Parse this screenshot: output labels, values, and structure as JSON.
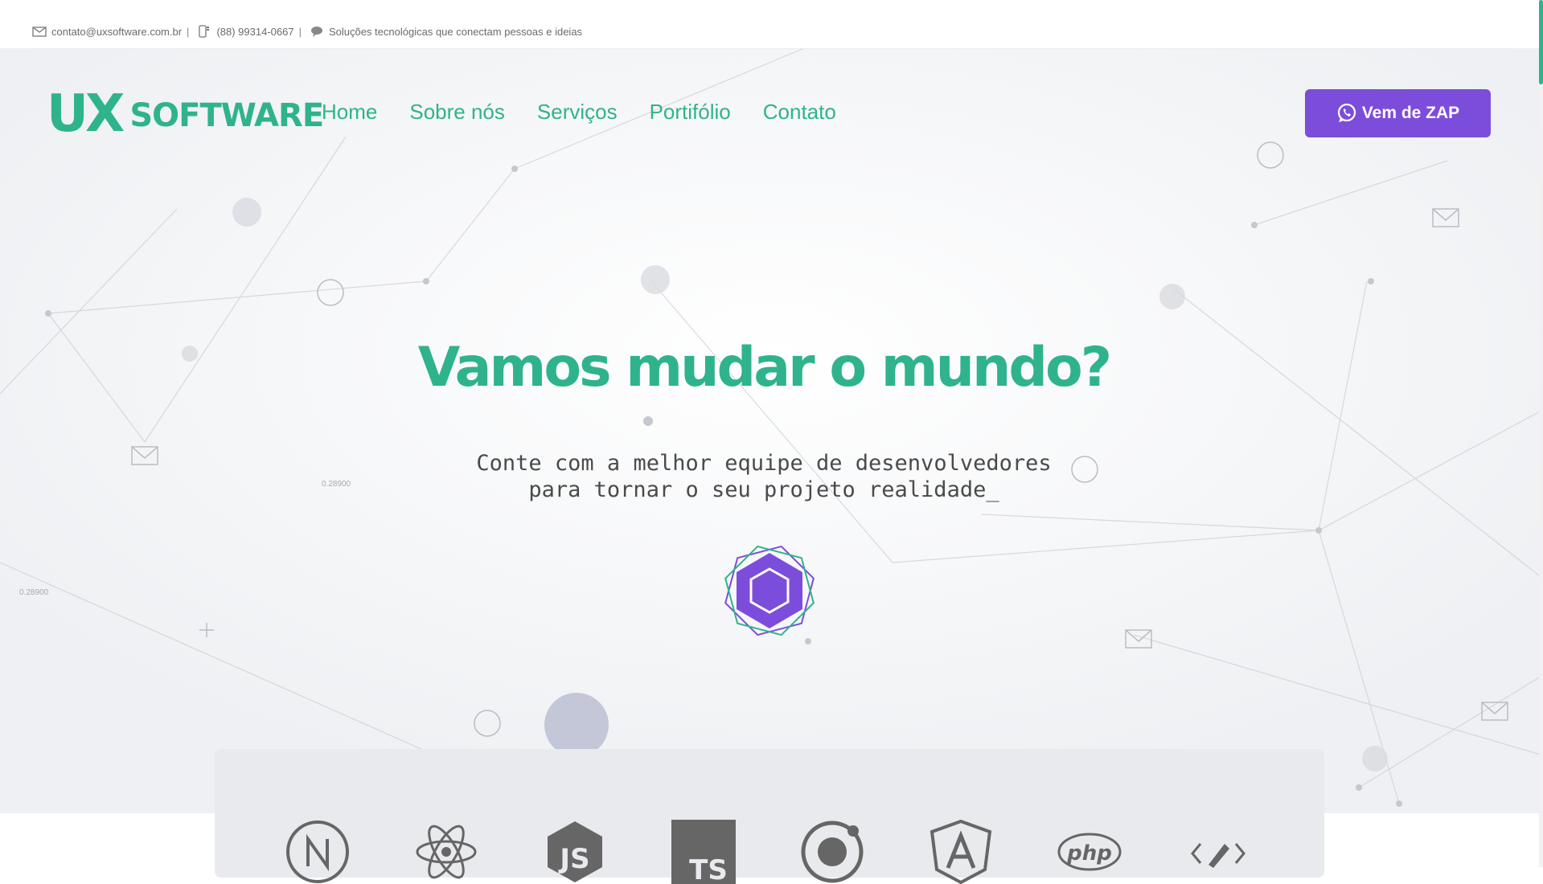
{
  "topbar": {
    "email": "contato@uxsoftware.com.br",
    "phone": "(88) 99314-0667",
    "tagline": "Soluções tecnológicas que conectam pessoas e ideias",
    "separator": "|"
  },
  "brand": {
    "mark": "UX",
    "word": "SOFTWARE"
  },
  "nav": {
    "items": [
      "Home",
      "Sobre nós",
      "Serviços",
      "Portifólio",
      "Contato"
    ]
  },
  "cta": {
    "label": "Vem de ZAP"
  },
  "hero": {
    "title": "Vamos mudar o mundo?",
    "subtitle": "Conte com a melhor equipe de desenvolvedores\npara tornar o seu projeto realidade_"
  },
  "background_labels": [
    "0.28900",
    "0.28900"
  ],
  "tech_icons": [
    "nextjs-icon",
    "react-icon",
    "nodejs-icon",
    "typescript-icon",
    "ionic-icon",
    "angular-icon",
    "php-icon",
    "code-icon"
  ],
  "colors": {
    "brand_green": "#2fb38c",
    "brand_purple": "#7c4ddb",
    "panel_gray": "#e9eaee"
  }
}
